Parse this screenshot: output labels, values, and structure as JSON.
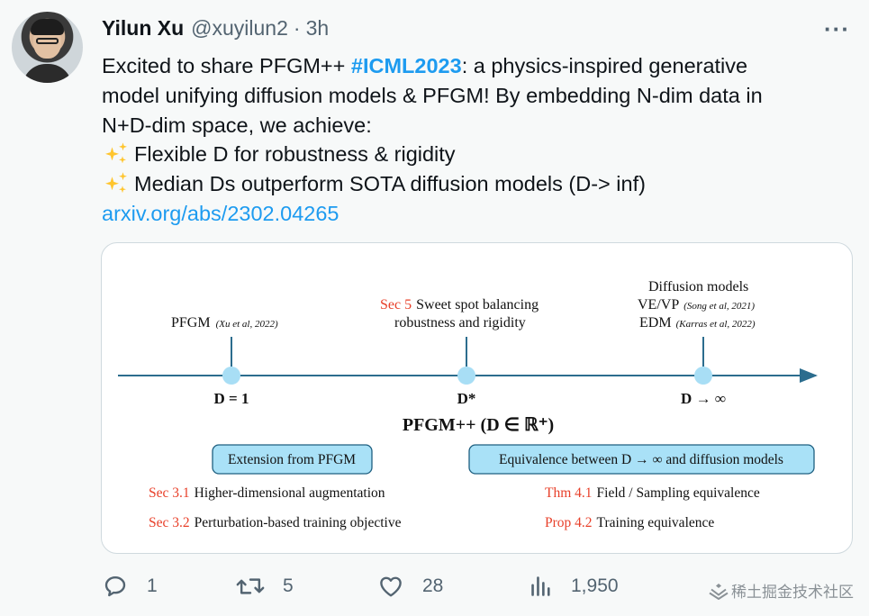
{
  "author": {
    "name": "Yilun Xu",
    "handle": "@xuyilun2",
    "separator": "·",
    "time": "3h",
    "more": "···"
  },
  "tweet": {
    "line1_pre": "Excited to share PFGM++ ",
    "hashtag": "#ICML2023",
    "line1_post": ": a physics-inspired generative",
    "line2": "model unifying diffusion models & PFGM! By embedding N-dim data in",
    "line3": "N+D-dim space, we achieve:",
    "bullet1": "Flexible D for robustness & rigidity",
    "bullet2": "Median Ds outperform SOTA diffusion models (D-> inf)",
    "link": "arxiv.org/abs/2302.04265"
  },
  "figure": {
    "pfgm_label": "PFGM",
    "pfgm_cite": "(Xu et al, 2022)",
    "sweet_sec": "Sec 5",
    "sweet_line1": "Sweet spot balancing",
    "sweet_line2": "robustness and rigidity",
    "diff_title": "Diffusion models",
    "vevp_label": "VE/VP",
    "vevp_cite": "(Song et al, 2021)",
    "edm_label": "EDM",
    "edm_cite": "(Karras et al, 2022)",
    "d1": "D = 1",
    "dstar": "D*",
    "dinf": "D → ∞",
    "main_title": "PFGM++ (D ∈ ℝ⁺)",
    "box_left": "Extension from PFGM",
    "box_right": "Equivalence between D → ∞ and diffusion models",
    "sec31": "Sec 3.1",
    "sec31_text": "Higher-dimensional augmentation",
    "sec32": "Sec 3.2",
    "sec32_text": "Perturbation-based training objective",
    "thm41": "Thm 4.1",
    "thm41_text": "Field / Sampling equivalence",
    "prop42": "Prop 4.2",
    "prop42_text": "Training equivalence",
    "colors": {
      "accent_red": "#e8402a",
      "node": "#a8def5",
      "axis": "#2c6d8e",
      "box_fill": "#a9e1f7"
    }
  },
  "actions": {
    "replies": "1",
    "retweets": "5",
    "likes": "28",
    "views": "1,950"
  },
  "watermark": "稀土掘金技术社区",
  "colors": {
    "link": "#1d9bf0",
    "muted": "#536471",
    "text": "#0f1419"
  }
}
